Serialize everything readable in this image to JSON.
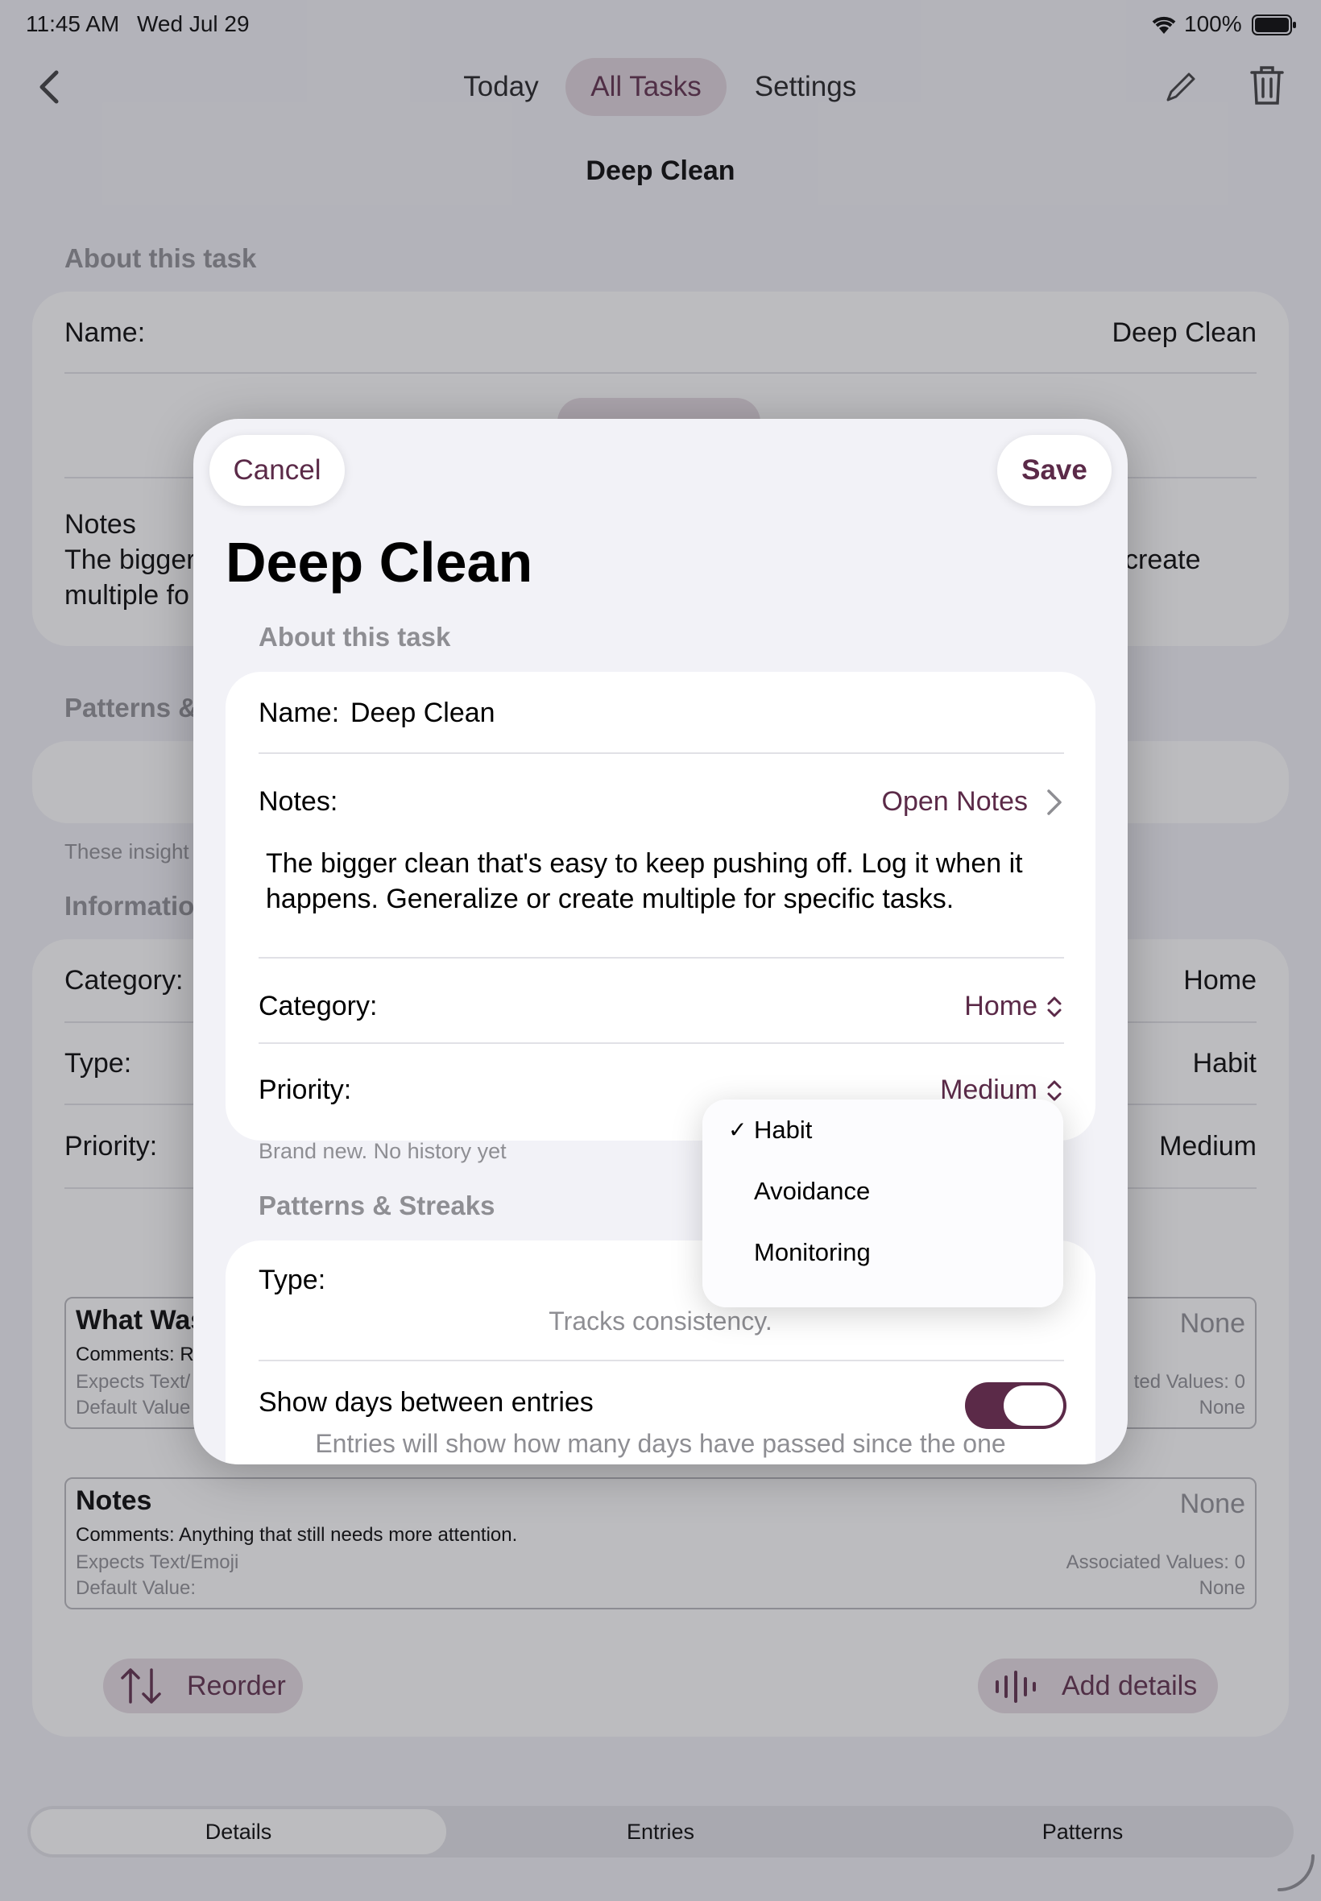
{
  "status_bar": {
    "time": "11:45 AM",
    "date": "Wed Jul 29",
    "battery": "100%"
  },
  "nav": {
    "tabs": [
      {
        "label": "Today"
      },
      {
        "label": "All Tasks"
      },
      {
        "label": "Settings"
      }
    ],
    "active_tab": "All Tasks",
    "title": "Deep Clean"
  },
  "background": {
    "about_header": "About this task",
    "name_label": "Name:",
    "name_value": "Deep Clean",
    "notes_label": "Notes",
    "notes_left_line1": "The bigger",
    "notes_left_line2": "multiple fo",
    "notes_right": "create",
    "patterns_header": "Patterns &",
    "insights_text": "These insight",
    "info_header": "Informatio",
    "category_label": "Category:",
    "category_value": "Home",
    "type_label": "Type:",
    "type_value": "Habit",
    "priority_label": "Priority:",
    "priority_value": "Medium",
    "field1": {
      "title": "What Was",
      "none": "None",
      "comments": "Comments: R",
      "expects": "Expects Text/",
      "default": "Default Value",
      "assoc": "ted Values: 0",
      "default_val": "None"
    },
    "field2": {
      "title": "Notes",
      "none": "None",
      "comments": "Comments: Anything that still needs more attention.",
      "expects": "Expects Text/Emoji",
      "default": "Default Value:",
      "assoc": "Associated Values: 0",
      "default_val": "None"
    },
    "reorder_label": "Reorder",
    "add_details_label": "Add details"
  },
  "bottom_tabs": [
    {
      "label": "Details"
    },
    {
      "label": "Entries"
    },
    {
      "label": "Patterns"
    }
  ],
  "modal": {
    "cancel_label": "Cancel",
    "save_label": "Save",
    "title": "Deep Clean",
    "about_header": "About this task",
    "name_label": "Name:",
    "name_value": "Deep Clean",
    "notes_label": "Notes:",
    "open_notes_label": "Open Notes",
    "notes_text": "The bigger clean that's easy to keep pushing off. Log it when it happens. Generalize or create multiple for specific tasks.",
    "category_label": "Category:",
    "category_value": "Home",
    "priority_label": "Priority:",
    "priority_value": "Medium",
    "history_hint": "Brand new. No history yet",
    "patterns_header": "Patterns & Streaks",
    "type_label": "Type:",
    "type_hint": "Tracks consistency.",
    "show_days_label": "Show days between entries",
    "show_days_on": true,
    "show_days_hint": "Entries will show how many days have passed since the one"
  },
  "type_menu": {
    "items": [
      {
        "label": "Habit",
        "check": "✓"
      },
      {
        "label": "Avoidance",
        "check": ""
      },
      {
        "label": "Monitoring",
        "check": ""
      }
    ],
    "selected": "Habit"
  },
  "colors": {
    "accent": "#5b2a48",
    "accent_light": "#e6dbe2",
    "background": "#f2f2f7"
  },
  "icons": [
    "back-chevron-icon",
    "pencil-icon",
    "trash-icon",
    "wifi-icon",
    "battery-icon",
    "chevron-right-icon",
    "up-down-chevron-icon",
    "reorder-arrows-icon",
    "waveform-icon"
  ]
}
